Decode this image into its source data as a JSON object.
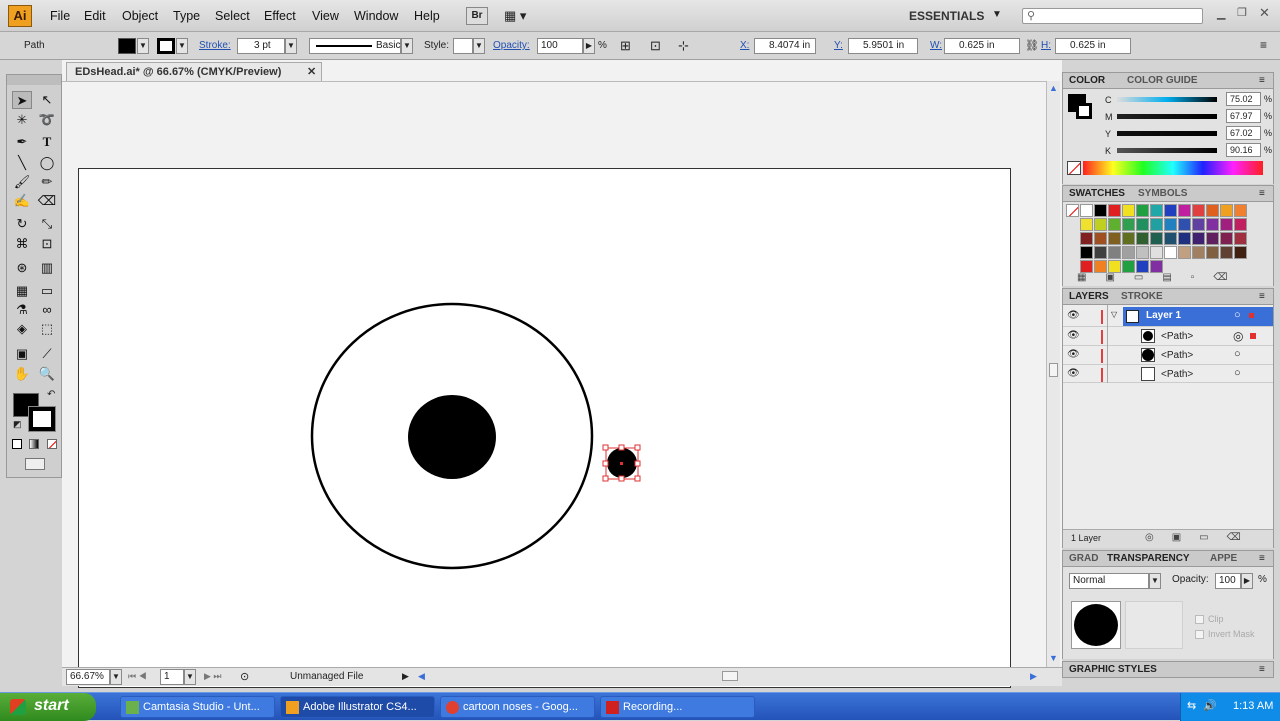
{
  "app": {
    "logo": "Ai",
    "workspace": "ESSENTIALS"
  },
  "menu": [
    "File",
    "Edit",
    "Object",
    "Type",
    "Select",
    "Effect",
    "View",
    "Window",
    "Help"
  ],
  "bridge": "Br",
  "control": {
    "selection_type": "Path",
    "stroke_label": "Stroke:",
    "stroke_value": "3 pt",
    "brush": "Basic",
    "style_label": "Style:",
    "opacity_label": "Opacity:",
    "opacity_value": "100",
    "opacity_unit": "%",
    "x_label": "X:",
    "x_value": "8.4074 in",
    "y_label": "Y:",
    "y_value": "5.9501 in",
    "w_label": "W:",
    "w_value": "0.625 in",
    "h_label": "H:",
    "h_value": "0.625 in"
  },
  "document": {
    "tab_title": "EDsHead.ai* @ 66.67% (CMYK/Preview)"
  },
  "status": {
    "zoom": "66.67%",
    "page": "1",
    "info": "Unmanaged File"
  },
  "color_panel": {
    "tabs": [
      "COLOR",
      "COLOR GUIDE"
    ],
    "channels": [
      {
        "label": "C",
        "value": "75.02"
      },
      {
        "label": "M",
        "value": "67.97"
      },
      {
        "label": "Y",
        "value": "67.02"
      },
      {
        "label": "K",
        "value": "90.16"
      }
    ],
    "unit": "%"
  },
  "swatches_panel": {
    "tabs": [
      "SWATCHES",
      "SYMBOLS"
    ],
    "rows": [
      [
        "#ffffff",
        "#000000",
        "#e02020",
        "#f0e020",
        "#20a040",
        "#20a8a8",
        "#2040c0",
        "#c020a0",
        "#e04040",
        "#e06020",
        "#f0a020",
        "#f08030"
      ],
      [
        "#f0e030",
        "#c0d020",
        "#60b030",
        "#30a050",
        "#209060",
        "#20a0a0",
        "#2080c0",
        "#3050b0",
        "#6040a0",
        "#8030a0",
        "#a02080",
        "#c02060"
      ],
      [
        "#802020",
        "#a05020",
        "#806020",
        "#607020",
        "#306030",
        "#206050",
        "#205070",
        "#203080",
        "#402070",
        "#602060",
        "#802050",
        "#a03040"
      ],
      [
        "#000000",
        "#303030",
        "#505050",
        "#707070",
        "#909090",
        "#b0b0b0",
        "#d0d0d0",
        "#c0a080",
        "#a08060",
        "#806040",
        "#604030",
        "#402010"
      ]
    ],
    "extra_row": [
      "#000000",
      "#404040",
      "#808080",
      "#a0a0a0",
      "#c0c0c0",
      "#e0e0e0",
      "#ffffff"
    ],
    "group_row": [
      "#e02020",
      "#f08020",
      "#f0e020",
      "#20a040",
      "#2040c0",
      "#8030a0"
    ]
  },
  "layers_panel": {
    "tabs": [
      "LAYERS",
      "STROKE"
    ],
    "layer_name": "Layer 1",
    "items": [
      "<Path>",
      "<Path>",
      "<Path>"
    ],
    "footer": "1 Layer"
  },
  "transparency_panel": {
    "tabs": [
      "GRAD",
      "TRANSPARENCY",
      "APPE"
    ],
    "blend_mode": "Normal",
    "opacity_label": "Opacity:",
    "opacity_value": "100",
    "opacity_unit": "%",
    "clip_label": "Clip",
    "invert_label": "Invert Mask"
  },
  "graphic_styles": {
    "title": "GRAPHIC STYLES"
  },
  "taskbar": {
    "start": "start",
    "items": [
      {
        "label": "Camtasia Studio - Unt...",
        "icon_color": "#6ab04c"
      },
      {
        "label": "Adobe Illustrator CS4...",
        "icon_color": "#f0a020"
      },
      {
        "label": "cartoon noses - Goog...",
        "icon_color": "#e04030"
      },
      {
        "label": "Recording...",
        "icon_color": "#d02020"
      }
    ],
    "clock": "1:13 AM"
  },
  "colors": {
    "accent": "#3a6fd8",
    "fill": "#000000",
    "stroke": "#000000",
    "selection": "#e03030"
  }
}
